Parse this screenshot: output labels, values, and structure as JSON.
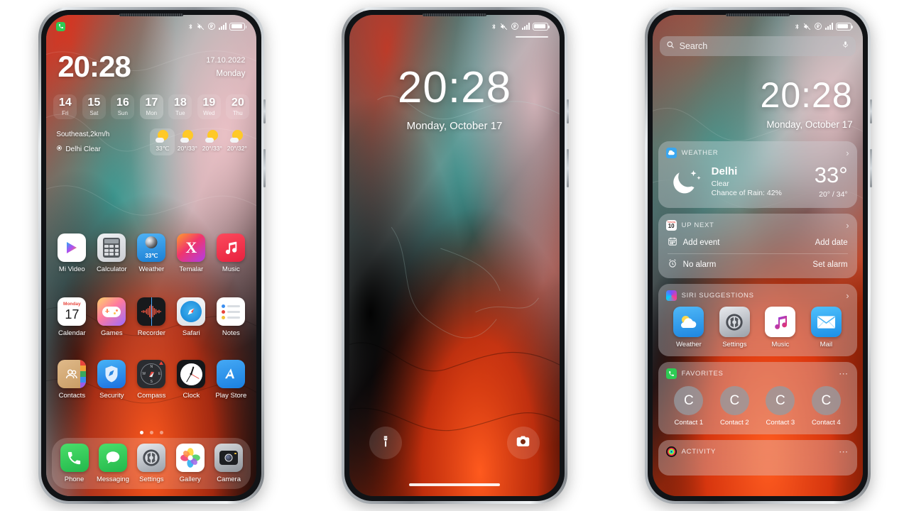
{
  "statusbar": {
    "icons": [
      "bluetooth-icon",
      "vibrate-off-icon",
      "roaming-icon",
      "signal-icon",
      "battery-icon"
    ],
    "notification_icon": "phone-icon"
  },
  "phone1": {
    "name": "home-screen",
    "time": "20:28",
    "date": "17.10.2022",
    "weekday": "Monday",
    "calendar": [
      {
        "num": "14",
        "dow": "Fri",
        "selected": false
      },
      {
        "num": "15",
        "dow": "Sat",
        "selected": false
      },
      {
        "num": "16",
        "dow": "Sun",
        "selected": false
      },
      {
        "num": "17",
        "dow": "Mon",
        "selected": true
      },
      {
        "num": "18",
        "dow": "Tue",
        "selected": false
      },
      {
        "num": "19",
        "dow": "Wed",
        "selected": false
      },
      {
        "num": "20",
        "dow": "Thu",
        "selected": false
      }
    ],
    "wind": "Southeast,2km/h",
    "location": "Delhi  Clear",
    "forecast": [
      {
        "temp": "33℃",
        "selected": true
      },
      {
        "temp": "20°/33°",
        "selected": false
      },
      {
        "temp": "20°/33°",
        "selected": false
      },
      {
        "temp": "20°/32°",
        "selected": false
      }
    ],
    "apps_row1": [
      {
        "label": "Mi Video",
        "icon": "mi-video-icon"
      },
      {
        "label": "Calculator",
        "icon": "calculator-icon"
      },
      {
        "label": "Weather",
        "icon": "weather-icon",
        "badge": "33℃"
      },
      {
        "label": "Temalar",
        "icon": "themes-icon"
      },
      {
        "label": "Music",
        "icon": "music-icon"
      }
    ],
    "apps_row2": [
      {
        "label": "Calendar",
        "icon": "calendar-icon",
        "day": "17",
        "weekday": "Monday"
      },
      {
        "label": "Games",
        "icon": "games-icon"
      },
      {
        "label": "Recorder",
        "icon": "recorder-icon"
      },
      {
        "label": "Safari",
        "icon": "safari-icon"
      },
      {
        "label": "Notes",
        "icon": "notes-icon"
      }
    ],
    "apps_row3": [
      {
        "label": "Contacts",
        "icon": "contacts-icon"
      },
      {
        "label": "Security",
        "icon": "security-icon"
      },
      {
        "label": "Compass",
        "icon": "compass-icon"
      },
      {
        "label": "Clock",
        "icon": "clock-icon"
      },
      {
        "label": "Play Store",
        "icon": "play-store-icon"
      }
    ],
    "dock": [
      {
        "label": "Phone",
        "icon": "phone-icon"
      },
      {
        "label": "Messaging",
        "icon": "messages-icon"
      },
      {
        "label": "Settings",
        "icon": "settings-icon"
      },
      {
        "label": "Gallery",
        "icon": "gallery-icon"
      },
      {
        "label": "Camera",
        "icon": "camera-icon"
      }
    ],
    "pages": {
      "count": 3,
      "active": 0
    }
  },
  "phone2": {
    "name": "lock-screen",
    "time": "20:28",
    "date": "Monday, October 17",
    "shortcuts": [
      {
        "name": "flashlight-icon"
      },
      {
        "name": "camera-icon"
      }
    ]
  },
  "phone3": {
    "name": "widgets-screen",
    "search_placeholder": "Search",
    "time": "20:28",
    "date": "Monday, October 17",
    "weather": {
      "header": "WEATHER",
      "city": "Delhi",
      "condition": "Clear",
      "rain": "Chance of Rain: 42%",
      "temp": "33°",
      "highlow": "20° / 34°",
      "icon": "moon-stars-icon"
    },
    "upnext": {
      "header": "UP NEXT",
      "badge_day": "10",
      "rows": [
        {
          "label": "Add event",
          "action": "Add date",
          "icon": "calendar-icon"
        },
        {
          "label": "No alarm",
          "action": "Set alarm",
          "icon": "alarm-icon"
        }
      ]
    },
    "siri": {
      "header": "SIRI SUGGESTIONS",
      "apps": [
        {
          "label": "Weather",
          "icon": "weather-icon"
        },
        {
          "label": "Settings",
          "icon": "settings-icon"
        },
        {
          "label": "Music",
          "icon": "music-icon"
        },
        {
          "label": "Mail",
          "icon": "mail-icon"
        }
      ]
    },
    "favorites": {
      "header": "FAVORITES",
      "contacts": [
        {
          "name": "Contact 1",
          "initial": "C"
        },
        {
          "name": "Contact 2",
          "initial": "C"
        },
        {
          "name": "Contact 3",
          "initial": "C"
        },
        {
          "name": "Contact 4",
          "initial": "C"
        }
      ]
    },
    "activity": {
      "header": "ACTIVITY"
    }
  },
  "colors": {
    "accent_green": "#2ecb54",
    "accent_orange": "#ff4a16",
    "accent_teal": "#2e8f88",
    "wallpaper_pink": "#d9a8ae"
  }
}
